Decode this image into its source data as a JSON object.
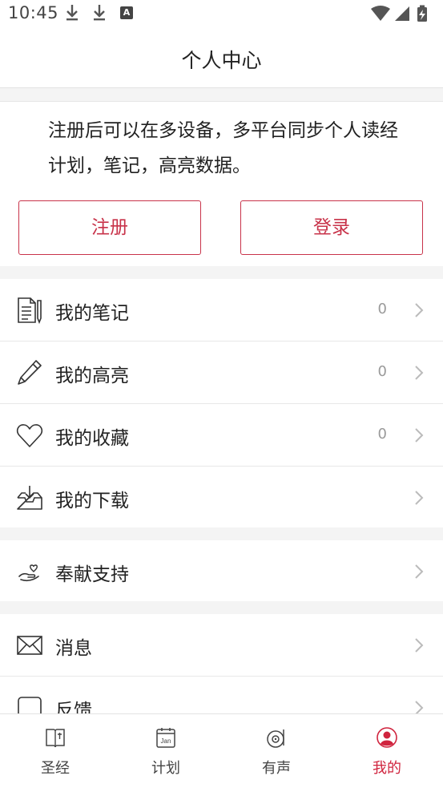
{
  "status_bar": {
    "time": "10:45",
    "notification_icons": [
      "download-icon",
      "download-icon",
      "keyboard-a-icon"
    ],
    "keyboard_glyph": "A",
    "right_icons": [
      "wifi-icon",
      "signal-icon",
      "battery-charging-icon"
    ]
  },
  "header": {
    "title": "个人中心"
  },
  "promo": {
    "text": "注册后可以在多设备，多平台同步个人读经计划，笔记，高亮数据。",
    "register_label": "注册",
    "login_label": "登录"
  },
  "menu_group_1": [
    {
      "icon": "notes-icon",
      "label": "我的笔记",
      "count": "0"
    },
    {
      "icon": "pencil-icon",
      "label": "我的高亮",
      "count": "0"
    },
    {
      "icon": "heart-icon",
      "label": "我的收藏",
      "count": "0"
    },
    {
      "icon": "download-tray-icon",
      "label": "我的下载",
      "count": ""
    }
  ],
  "menu_group_2": [
    {
      "icon": "offering-hand-icon",
      "label": "奉献支持"
    }
  ],
  "menu_group_3": [
    {
      "icon": "envelope-icon",
      "label": "消息"
    },
    {
      "icon": "feedback-icon",
      "label": "反馈"
    }
  ],
  "tabbar": [
    {
      "icon": "bible-icon",
      "label": "圣经",
      "active": false
    },
    {
      "icon": "calendar-icon",
      "label": "计划",
      "active": false,
      "icon_text": "Jan"
    },
    {
      "icon": "audio-disc-icon",
      "label": "有声",
      "active": false
    },
    {
      "icon": "user-icon",
      "label": "我的",
      "active": true
    }
  ],
  "colors": {
    "accent": "#d0243e",
    "button_border": "#c8334a",
    "background": "#f4f4f4"
  }
}
